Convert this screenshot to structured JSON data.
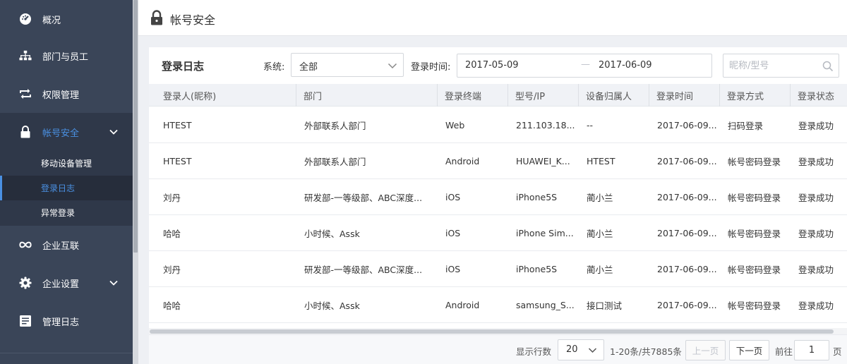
{
  "sidebar": {
    "items": [
      {
        "label": "概况",
        "icon": "dashboard-icon"
      },
      {
        "label": "部门与员工",
        "icon": "org-chart-icon"
      },
      {
        "label": "权限管理",
        "icon": "repeat-icon"
      },
      {
        "label": "帐号安全",
        "icon": "lock-icon"
      },
      {
        "label": "企业互联",
        "icon": "infinity-icon"
      },
      {
        "label": "企业设置",
        "icon": "gear-icon"
      },
      {
        "label": "管理日志",
        "icon": "log-icon"
      }
    ],
    "submenu": [
      {
        "label": "移动设备管理"
      },
      {
        "label": "登录日志"
      },
      {
        "label": "异常登录"
      }
    ],
    "active_item": "帐号安全",
    "active_sub": "登录日志"
  },
  "header": {
    "title": "帐号安全",
    "icon": "lock-icon"
  },
  "card": {
    "title": "登录日志",
    "filters": {
      "system_label": "系统:",
      "system_value": "全部",
      "time_label": "登录时间:",
      "date_start": "2017-05-09",
      "date_sep": "—",
      "date_end": "2017-06-09",
      "search_placeholder": "昵称/型号"
    },
    "columns": [
      "登录人(昵称)",
      "部门",
      "登录终端",
      "型号/IP",
      "设备归属人",
      "登录时间",
      "登录方式",
      "登录状态"
    ],
    "rows": [
      [
        "HTEST",
        "外部联系人部门",
        "Web",
        "211.103.18...",
        "--",
        "2017-06-09...",
        "扫码登录",
        "登录成功"
      ],
      [
        "HTEST",
        "外部联系人部门",
        "Android",
        "HUAWEI_K...",
        "HTEST",
        "2017-06-09...",
        "帐号密码登录",
        "登录成功"
      ],
      [
        "刘丹",
        "研发部-一等级部、ABC深度...",
        "iOS",
        "iPhone5S",
        "蔺小兰",
        "2017-06-09...",
        "帐号密码登录",
        "登录成功"
      ],
      [
        "哈哈",
        "小时候、Assk",
        "iOS",
        "iPhone Sim...",
        "蔺小兰",
        "2017-06-09...",
        "帐号密码登录",
        "登录成功"
      ],
      [
        "刘丹",
        "研发部-一等级部、ABC深度...",
        "iOS",
        "iPhone5S",
        "蔺小兰",
        "2017-06-09...",
        "帐号密码登录",
        "登录成功"
      ],
      [
        "哈哈",
        "小时候、Assk",
        "Android",
        "samsung_S...",
        "接口测试",
        "2017-06-09...",
        "帐号密码登录",
        "登录成功"
      ]
    ]
  },
  "pagination": {
    "rows_label": "显示行数",
    "rows_value": "20",
    "range_text": "1-20条/共7885条",
    "prev_label": "上一页",
    "next_label": "下一页",
    "goto_label": "前往",
    "page_value": "1",
    "page_suffix": "页"
  },
  "colors": {
    "sidebar_bg": "#3a4558",
    "sidebar_active_bg": "#2f3849",
    "accent": "#4a90e2"
  }
}
